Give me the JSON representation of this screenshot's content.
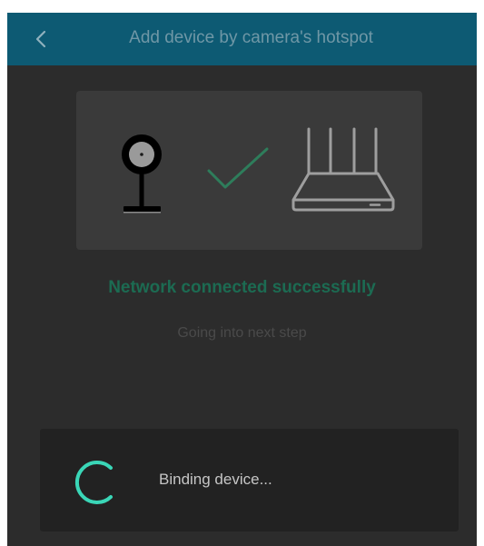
{
  "header": {
    "title": "Add device by camera's hotspot",
    "back_icon": "chevron-left-icon",
    "background_color": "#0d5a73"
  },
  "illustration": {
    "camera_icon": "camera-icon",
    "check_icon": "checkmark-icon",
    "router_icon": "router-icon",
    "check_color": "#2e7d5b"
  },
  "status": {
    "title": "Network connected successfully",
    "subtitle": "Going into next step",
    "title_color": "#1c6b52"
  },
  "binding": {
    "label": "Binding device...",
    "spinner_icon": "loading-spinner-icon",
    "spinner_color": "#3ad6b7"
  }
}
